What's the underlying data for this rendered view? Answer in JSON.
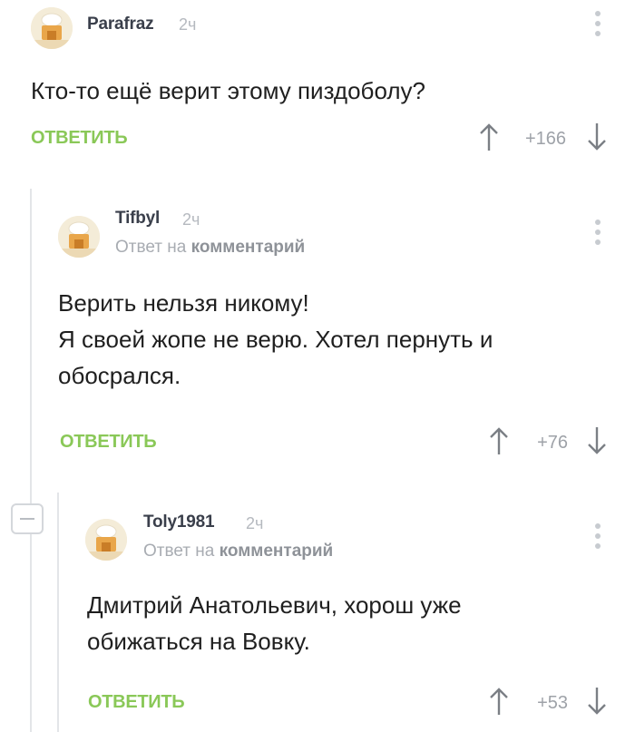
{
  "comments": [
    {
      "author": "Parafraz",
      "time": "2ч",
      "text": "Кто-то ещё верит этому пиздоболу?",
      "reply_label": "ОТВЕТИТЬ",
      "rating": "+166"
    },
    {
      "author": "Tifbyl",
      "time": "2ч",
      "reply_prefix": "Ответ на",
      "reply_target": "комментарий",
      "text": "Верить нельзя никому!\nЯ своей жопе не верю. Хотел пернуть и обосрался.",
      "reply_label": "ОТВЕТИТЬ",
      "rating": "+76"
    },
    {
      "author": "Toly1981",
      "time": "2ч",
      "reply_prefix": "Ответ на",
      "reply_target": "комментарий",
      "text": "Дмитрий Анатольевич, хорош уже обижаться на Вовку.",
      "reply_label": "ОТВЕТИТЬ",
      "rating": "+53"
    }
  ],
  "icons": {
    "upvote": "arrow-up-icon",
    "downvote": "arrow-down-icon",
    "menu": "more-vertical-icon",
    "collapse": "minus-icon"
  },
  "colors": {
    "accent": "#8ac858",
    "muted": "#a8acb2",
    "thread": "#e3e5e8"
  }
}
